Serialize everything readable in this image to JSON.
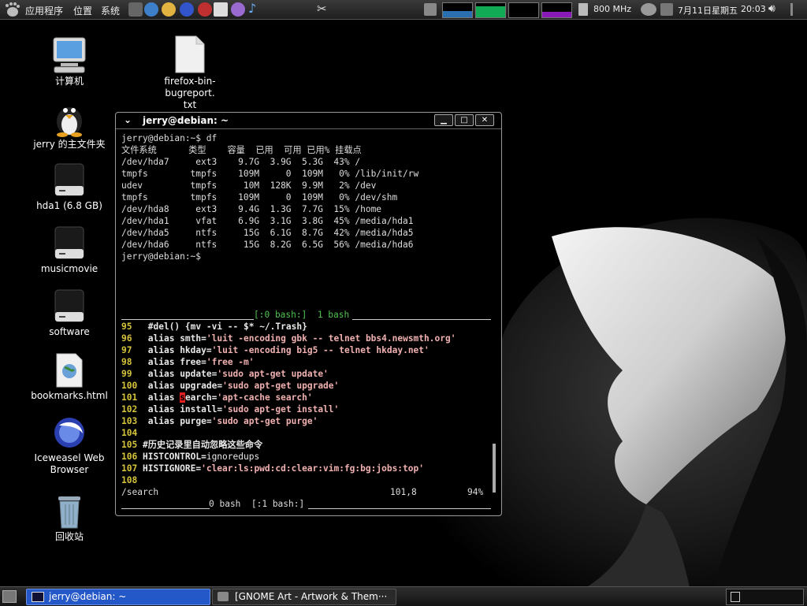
{
  "top_panel": {
    "menus": [
      "应用程序",
      "位置",
      "系统"
    ],
    "cpu_freq": "800 MHz",
    "clock_date": "7月11日星期五",
    "clock_time": "20:03"
  },
  "desktop": {
    "icons": [
      {
        "label": "计算机",
        "icon": "computer-icon"
      },
      {
        "label": "firefox-bin-bugreport.",
        "label2": "txt",
        "icon": "text-file-icon"
      },
      {
        "label": "jerry 的主文件夹",
        "icon": "home-penguin-icon"
      },
      {
        "label": "hda1 (6.8 GB)",
        "icon": "drive-icon"
      },
      {
        "label": "musicmovie",
        "icon": "drive-icon"
      },
      {
        "label": "software",
        "icon": "drive-icon"
      },
      {
        "label": "bookmarks.html",
        "icon": "html-file-icon"
      },
      {
        "label": "Iceweasel Web",
        "label2": "Browser",
        "icon": "iceweasel-icon"
      },
      {
        "label": "回收站",
        "icon": "trash-icon"
      }
    ]
  },
  "terminal": {
    "title": "jerry@debian: ~",
    "df_lines": [
      "jerry@debian:~$ df",
      "文件系统      类型    容量  已用  可用 已用% 挂载点",
      "/dev/hda7     ext3    9.7G  3.9G  5.3G  43% /",
      "tmpfs        tmpfs    109M     0  109M   0% /lib/init/rw",
      "udev         tmpfs     10M  128K  9.9M   2% /dev",
      "tmpfs        tmpfs    109M     0  109M   0% /dev/shm",
      "/dev/hda8     ext3    9.4G  1.3G  7.7G  15% /home",
      "/dev/hda1     vfat    6.9G  3.1G  3.8G  45% /media/hda1",
      "/dev/hda5     ntfs     15G  6.1G  8.7G  42% /media/hda5",
      "/dev/hda6     ntfs     15G  8.2G  6.5G  56% /media/hda6",
      "jerry@debian:~$"
    ],
    "tmux_top": "[:0 bash:]  1 bash",
    "vim_lines": [
      {
        "n": "95",
        "kw": "",
        "text": "#del() {mv -vi -- $* ~/.Trash}"
      },
      {
        "n": "96",
        "kw": "alias",
        "name": "smth=",
        "str": "'luit -encoding gbk -- telnet bbs4.newsmth.org'"
      },
      {
        "n": "97",
        "kw": "alias",
        "name": "hkday=",
        "str": "'luit -encoding big5 -- telnet hkday.net'"
      },
      {
        "n": "98",
        "kw": "alias",
        "name": "free=",
        "str": "'free -m'"
      },
      {
        "n": "99",
        "kw": "alias",
        "name": "update=",
        "str": "'sudo apt-get update'"
      },
      {
        "n": "100",
        "kw": "alias",
        "name": "upgrade=",
        "str": "'sudo apt-get upgrade'"
      },
      {
        "n": "101",
        "kw": "alias",
        "name": "search=",
        "str": "'apt-cache search'"
      },
      {
        "n": "102",
        "kw": "alias",
        "name": "install=",
        "str": "'sudo apt-get install'"
      },
      {
        "n": "103",
        "kw": "alias",
        "name": "purge=",
        "str": "'sudo apt-get purge'"
      },
      {
        "n": "104",
        "kw": "",
        "text": ""
      },
      {
        "n": "105",
        "kw": "",
        "text": "#历史记录里自动忽略这些命令"
      },
      {
        "n": "106",
        "kw": "",
        "name": "HISTCONTROL=",
        "plain": "ignoredups"
      },
      {
        "n": "107",
        "kw": "",
        "name": "HISTIGNORE=",
        "str": "'clear:ls:pwd:cd:clear:vim:fg:bg:jobs:top'"
      },
      {
        "n": "108",
        "kw": "",
        "text": ""
      }
    ],
    "vim_status_left": "/search",
    "vim_status_pos": "101,8",
    "vim_status_pct": "94%",
    "tmux_bottom": "0 bash  [:1 bash:]"
  },
  "taskbar": {
    "tasks": [
      "jerry@debian: ~",
      "[GNOME Art - Artwork & Them···"
    ]
  }
}
